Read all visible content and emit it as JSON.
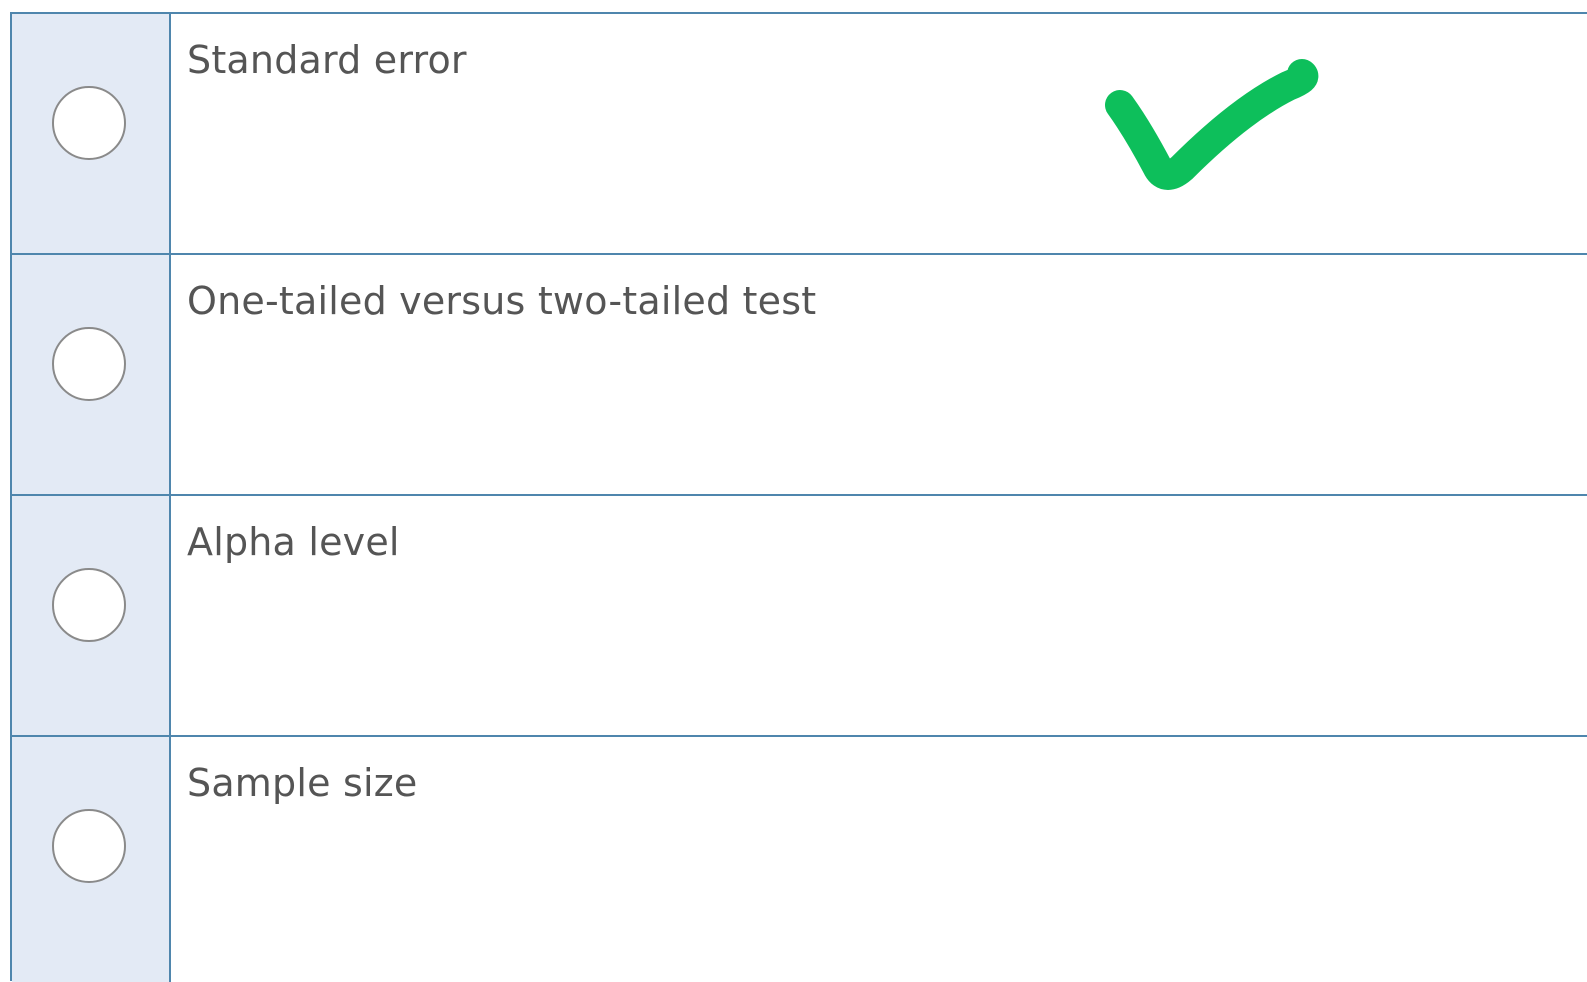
{
  "question": {
    "options": [
      {
        "label": "Standard error",
        "selected": false
      },
      {
        "label": "One-tailed versus two-tailed test",
        "selected": false
      },
      {
        "label": "Alpha level",
        "selected": false
      },
      {
        "label": "Sample size",
        "selected": false
      }
    ]
  },
  "annotation": {
    "icon": "checkmark-icon",
    "marks_option": "Standard error",
    "color": "#0dbf5b"
  },
  "colors": {
    "border": "#4f86ad",
    "radio_cell_background": "#e3eaf5",
    "radio_border": "#8a8a8a",
    "label_text": "#555555"
  }
}
